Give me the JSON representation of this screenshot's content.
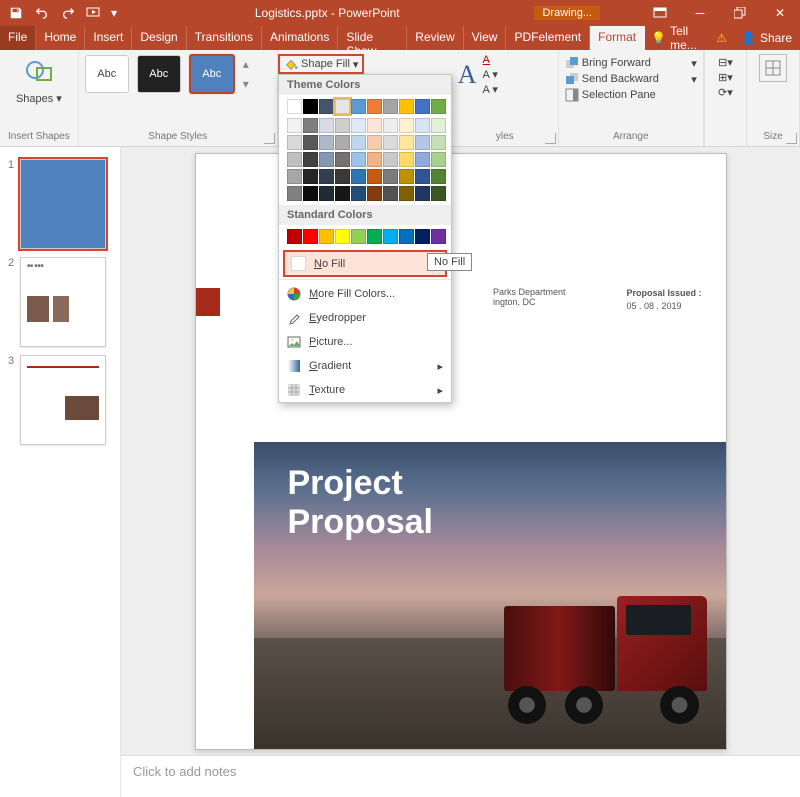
{
  "titlebar": {
    "doc": "Logistics.pptx - PowerPoint",
    "context": "Drawing..."
  },
  "tabs": {
    "file": "File",
    "home": "Home",
    "insert": "Insert",
    "design": "Design",
    "transitions": "Transitions",
    "animations": "Animations",
    "slideshow": "Slide Show",
    "review": "Review",
    "view": "View",
    "pdf": "PDFelement",
    "format": "Format",
    "tell": "Tell me...",
    "share": "Share"
  },
  "ribbon": {
    "shapes": "Shapes",
    "insert_shapes": "Insert Shapes",
    "shape_styles": "Shape Styles",
    "abc": "Abc",
    "shape_fill": "Shape Fill",
    "wordart": "yles",
    "bring": "Bring Forward",
    "send": "Send Backward",
    "selpane": "Selection Pane",
    "arrange": "Arrange",
    "size": "Size"
  },
  "dropdown": {
    "theme_colors": "Theme Colors",
    "standard_colors": "Standard Colors",
    "no_fill": "No Fill",
    "more": "More Fill Colors...",
    "eyedrop": "Eyedropper",
    "picture": "Picture...",
    "gradient": "Gradient",
    "texture": "Texture",
    "tooltip": "No Fill",
    "theme_row": [
      "#ffffff",
      "#000000",
      "#44546a",
      "#e7e6e6",
      "#5b9bd5",
      "#ed7d31",
      "#a5a5a5",
      "#ffc000",
      "#4472c4",
      "#70ad47"
    ],
    "theme_shades": [
      [
        "#f2f2f2",
        "#7f7f7f",
        "#d6dce5",
        "#cfcdcd",
        "#deebf7",
        "#fbe5d6",
        "#ededed",
        "#fff2cc",
        "#dae3f3",
        "#e2f0d9"
      ],
      [
        "#d9d9d9",
        "#595959",
        "#adb9ca",
        "#aeabab",
        "#bdd7ee",
        "#f8cbad",
        "#dbdbdb",
        "#ffe699",
        "#b4c7e7",
        "#c5e0b4"
      ],
      [
        "#bfbfbf",
        "#404040",
        "#8497b0",
        "#757171",
        "#9dc3e6",
        "#f4b183",
        "#c9c9c9",
        "#ffd966",
        "#8faadc",
        "#a9d18e"
      ],
      [
        "#a6a6a6",
        "#262626",
        "#333f50",
        "#3b3838",
        "#2e75b6",
        "#c55a11",
        "#7b7b7b",
        "#bf9000",
        "#2f5597",
        "#548235"
      ],
      [
        "#808080",
        "#0d0d0d",
        "#222a35",
        "#181717",
        "#1f4e79",
        "#843c0c",
        "#525252",
        "#806000",
        "#203864",
        "#385723"
      ]
    ],
    "standard": [
      "#c00000",
      "#ff0000",
      "#ffc000",
      "#ffff00",
      "#92d050",
      "#00b050",
      "#00b0f0",
      "#0070c0",
      "#002060",
      "#7030a0"
    ]
  },
  "slide": {
    "proposal_label": "Proposal Issued :",
    "proposal_date": "05 . 08 . 2019",
    "dept1": "Parks Department",
    "dept2": "ington, DC",
    "title1": "Project",
    "title2": "Proposal"
  },
  "notes": "Click to add notes",
  "slide_numbers": [
    "1",
    "2",
    "3"
  ]
}
